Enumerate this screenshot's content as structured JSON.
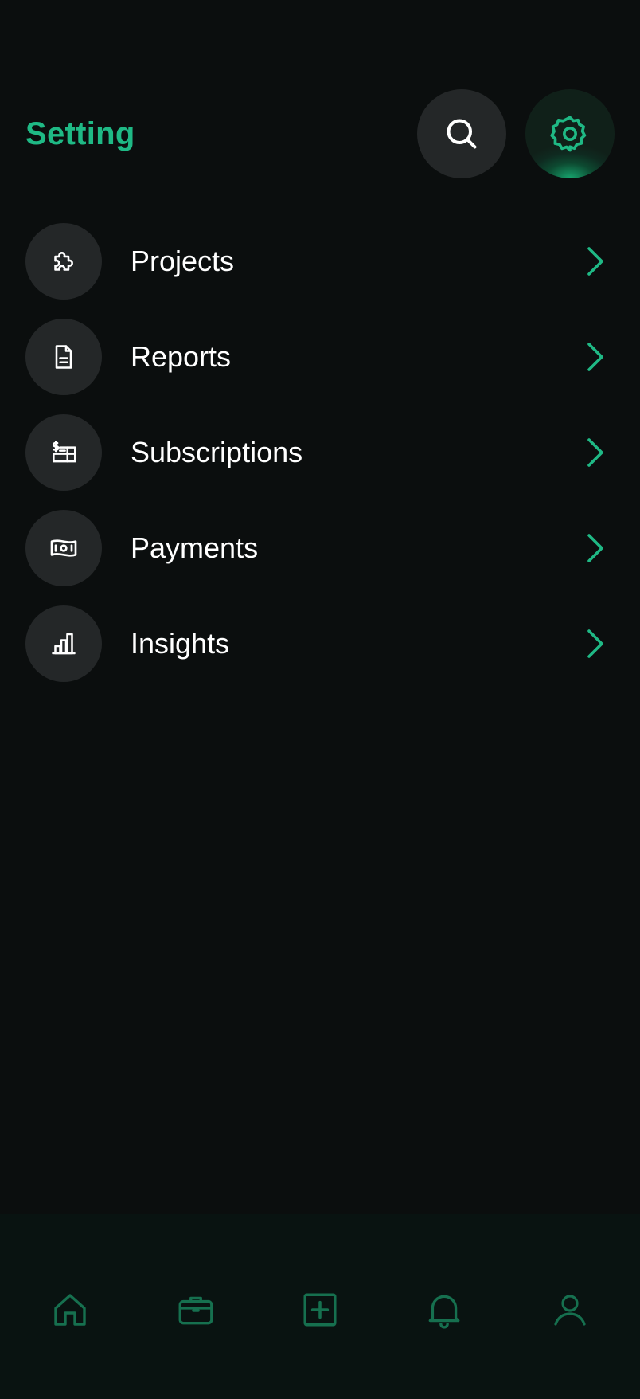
{
  "header": {
    "title": "Setting",
    "search_icon": "search-icon",
    "settings_icon": "gear-icon"
  },
  "menu": {
    "items": [
      {
        "label": "Projects",
        "icon": "puzzle-icon"
      },
      {
        "label": "Reports",
        "icon": "document-icon"
      },
      {
        "label": "Subscriptions",
        "icon": "receipt-icon"
      },
      {
        "label": "Payments",
        "icon": "banknote-icon"
      },
      {
        "label": "Insights",
        "icon": "bar-chart-icon"
      }
    ]
  },
  "tabbar": {
    "tabs": [
      {
        "icon": "home-icon"
      },
      {
        "icon": "briefcase-icon"
      },
      {
        "icon": "add-square-icon"
      },
      {
        "icon": "bell-icon"
      },
      {
        "icon": "user-icon"
      }
    ]
  },
  "colors": {
    "accent": "#1fb985",
    "background": "#0b0e0e",
    "surface": "#242728",
    "tabbar": "#091311",
    "tab_icon": "#16704f"
  }
}
